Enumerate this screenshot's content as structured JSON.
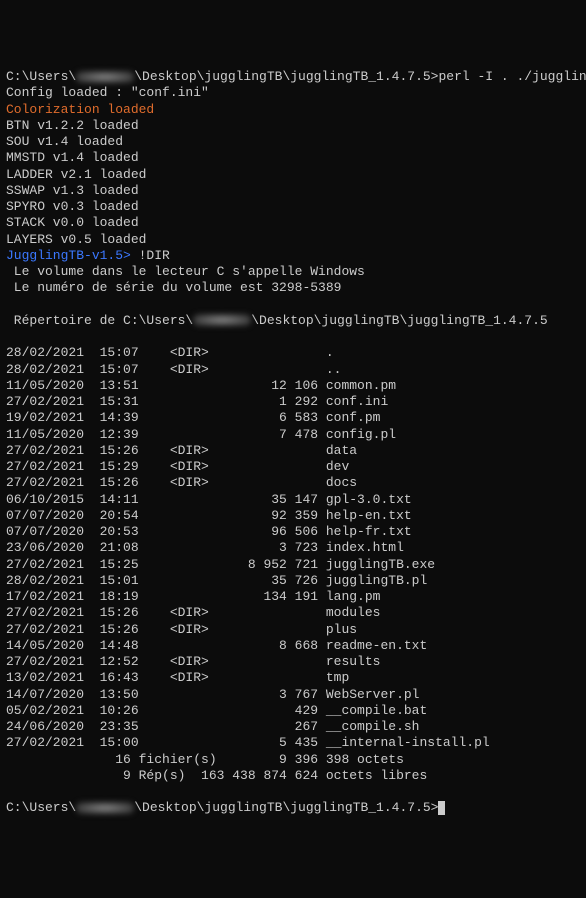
{
  "prompt_line": {
    "prefix": "C:\\Users\\",
    "redacted_width": 58,
    "suffix": "\\Desktop\\jugglingTB\\jugglingTB_1.4.7.5>",
    "command": "perl -I . ./jugglingTB.pl"
  },
  "startup": {
    "config_loaded": "Config loaded : \"conf.ini\"",
    "colorization": "Colorization loaded",
    "modules": [
      "BTN v1.2.2 loaded",
      "SOU v1.4 loaded",
      "MMSTD v1.4 loaded",
      "LADDER v2.1 loaded",
      "SSWAP v1.3 loaded",
      "SPYRO v0.3 loaded",
      "STACK v0.0 loaded",
      "LAYERS v0.5 loaded"
    ]
  },
  "inner_prompt": {
    "label": "JugglingTB-v1.5>",
    "command": " !DIR"
  },
  "dir_header": {
    "l1": " Le volume dans le lecteur C s'appelle Windows",
    "l2": " Le numéro de série du volume est 3298-5389",
    "l3_prefix": " Répertoire de C:\\Users\\",
    "l3_redacted_width": 58,
    "l3_suffix": "\\Desktop\\jugglingTB\\jugglingTB_1.4.7.5"
  },
  "listing": [
    {
      "date": "28/02/2021",
      "time": "15:07",
      "dir": "<DIR>",
      "size": "",
      "name": "."
    },
    {
      "date": "28/02/2021",
      "time": "15:07",
      "dir": "<DIR>",
      "size": "",
      "name": ".."
    },
    {
      "date": "11/05/2020",
      "time": "13:51",
      "dir": "",
      "size": "12 106",
      "name": "common.pm"
    },
    {
      "date": "27/02/2021",
      "time": "15:31",
      "dir": "",
      "size": "1 292",
      "name": "conf.ini"
    },
    {
      "date": "19/02/2021",
      "time": "14:39",
      "dir": "",
      "size": "6 583",
      "name": "conf.pm"
    },
    {
      "date": "11/05/2020",
      "time": "12:39",
      "dir": "",
      "size": "7 478",
      "name": "config.pl"
    },
    {
      "date": "27/02/2021",
      "time": "15:26",
      "dir": "<DIR>",
      "size": "",
      "name": "data"
    },
    {
      "date": "27/02/2021",
      "time": "15:29",
      "dir": "<DIR>",
      "size": "",
      "name": "dev"
    },
    {
      "date": "27/02/2021",
      "time": "15:26",
      "dir": "<DIR>",
      "size": "",
      "name": "docs"
    },
    {
      "date": "06/10/2015",
      "time": "14:11",
      "dir": "",
      "size": "35 147",
      "name": "gpl-3.0.txt"
    },
    {
      "date": "07/07/2020",
      "time": "20:54",
      "dir": "",
      "size": "92 359",
      "name": "help-en.txt"
    },
    {
      "date": "07/07/2020",
      "time": "20:53",
      "dir": "",
      "size": "96 506",
      "name": "help-fr.txt"
    },
    {
      "date": "23/06/2020",
      "time": "21:08",
      "dir": "",
      "size": "3 723",
      "name": "index.html"
    },
    {
      "date": "27/02/2021",
      "time": "15:25",
      "dir": "",
      "size": "8 952 721",
      "name": "jugglingTB.exe"
    },
    {
      "date": "28/02/2021",
      "time": "15:01",
      "dir": "",
      "size": "35 726",
      "name": "jugglingTB.pl"
    },
    {
      "date": "17/02/2021",
      "time": "18:19",
      "dir": "",
      "size": "134 191",
      "name": "lang.pm"
    },
    {
      "date": "27/02/2021",
      "time": "15:26",
      "dir": "<DIR>",
      "size": "",
      "name": "modules"
    },
    {
      "date": "27/02/2021",
      "time": "15:26",
      "dir": "<DIR>",
      "size": "",
      "name": "plus"
    },
    {
      "date": "14/05/2020",
      "time": "14:48",
      "dir": "",
      "size": "8 668",
      "name": "readme-en.txt"
    },
    {
      "date": "27/02/2021",
      "time": "12:52",
      "dir": "<DIR>",
      "size": "",
      "name": "results"
    },
    {
      "date": "13/02/2021",
      "time": "16:43",
      "dir": "<DIR>",
      "size": "",
      "name": "tmp"
    },
    {
      "date": "14/07/2020",
      "time": "13:50",
      "dir": "",
      "size": "3 767",
      "name": "WebServer.pl"
    },
    {
      "date": "05/02/2021",
      "time": "10:26",
      "dir": "",
      "size": "429",
      "name": "__compile.bat"
    },
    {
      "date": "24/06/2020",
      "time": "23:35",
      "dir": "",
      "size": "267",
      "name": "__compile.sh"
    },
    {
      "date": "27/02/2021",
      "time": "15:00",
      "dir": "",
      "size": "5 435",
      "name": "__internal-install.pl"
    }
  ],
  "summary": {
    "files_line": "              16 fichier(s)        9 396 398 octets",
    "dirs_line": "               9 Rép(s)  163 438 874 624 octets libres"
  },
  "end_prompt": {
    "prefix": "C:\\Users\\",
    "redacted_width": 58,
    "suffix": "\\Desktop\\jugglingTB\\jugglingTB_1.4.7.5>"
  }
}
